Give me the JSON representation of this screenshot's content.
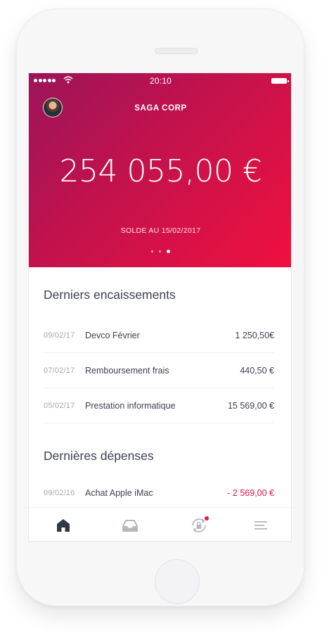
{
  "status_bar": {
    "time": "20:10"
  },
  "header": {
    "company": "SAGA CORP",
    "balance": "254 055,00 €",
    "balance_label": "SOLDE AU 15/02/2017",
    "pages": 3,
    "active_page": 3
  },
  "income": {
    "title": "Derniers encaissements",
    "rows": [
      {
        "date": "09/02/17",
        "label": "Devco Février",
        "amount": "1 250,50€"
      },
      {
        "date": "07/02/17",
        "label": "Remboursement frais",
        "amount": "440,50 €"
      },
      {
        "date": "05/02/17",
        "label": "Prestation informatique",
        "amount": "15 569,00 €"
      }
    ]
  },
  "expenses": {
    "title": "Dernières dépenses",
    "rows": [
      {
        "date": "09/02/16",
        "label": "Achat Apple iMac",
        "amount": "- 2 569,00 €"
      }
    ]
  },
  "tabbar": {
    "items": [
      {
        "icon": "home-icon",
        "active": true
      },
      {
        "icon": "inbox-icon",
        "active": false
      },
      {
        "icon": "sync-lock-icon",
        "active": false,
        "has_notification": true
      },
      {
        "icon": "menu-icon",
        "active": false
      }
    ]
  },
  "colors": {
    "accent": "#e6144a",
    "gradient_start": "#9c1459",
    "gradient_end": "#f0103f",
    "text_dark": "#3d4350",
    "text_muted": "#a3a8b0"
  }
}
